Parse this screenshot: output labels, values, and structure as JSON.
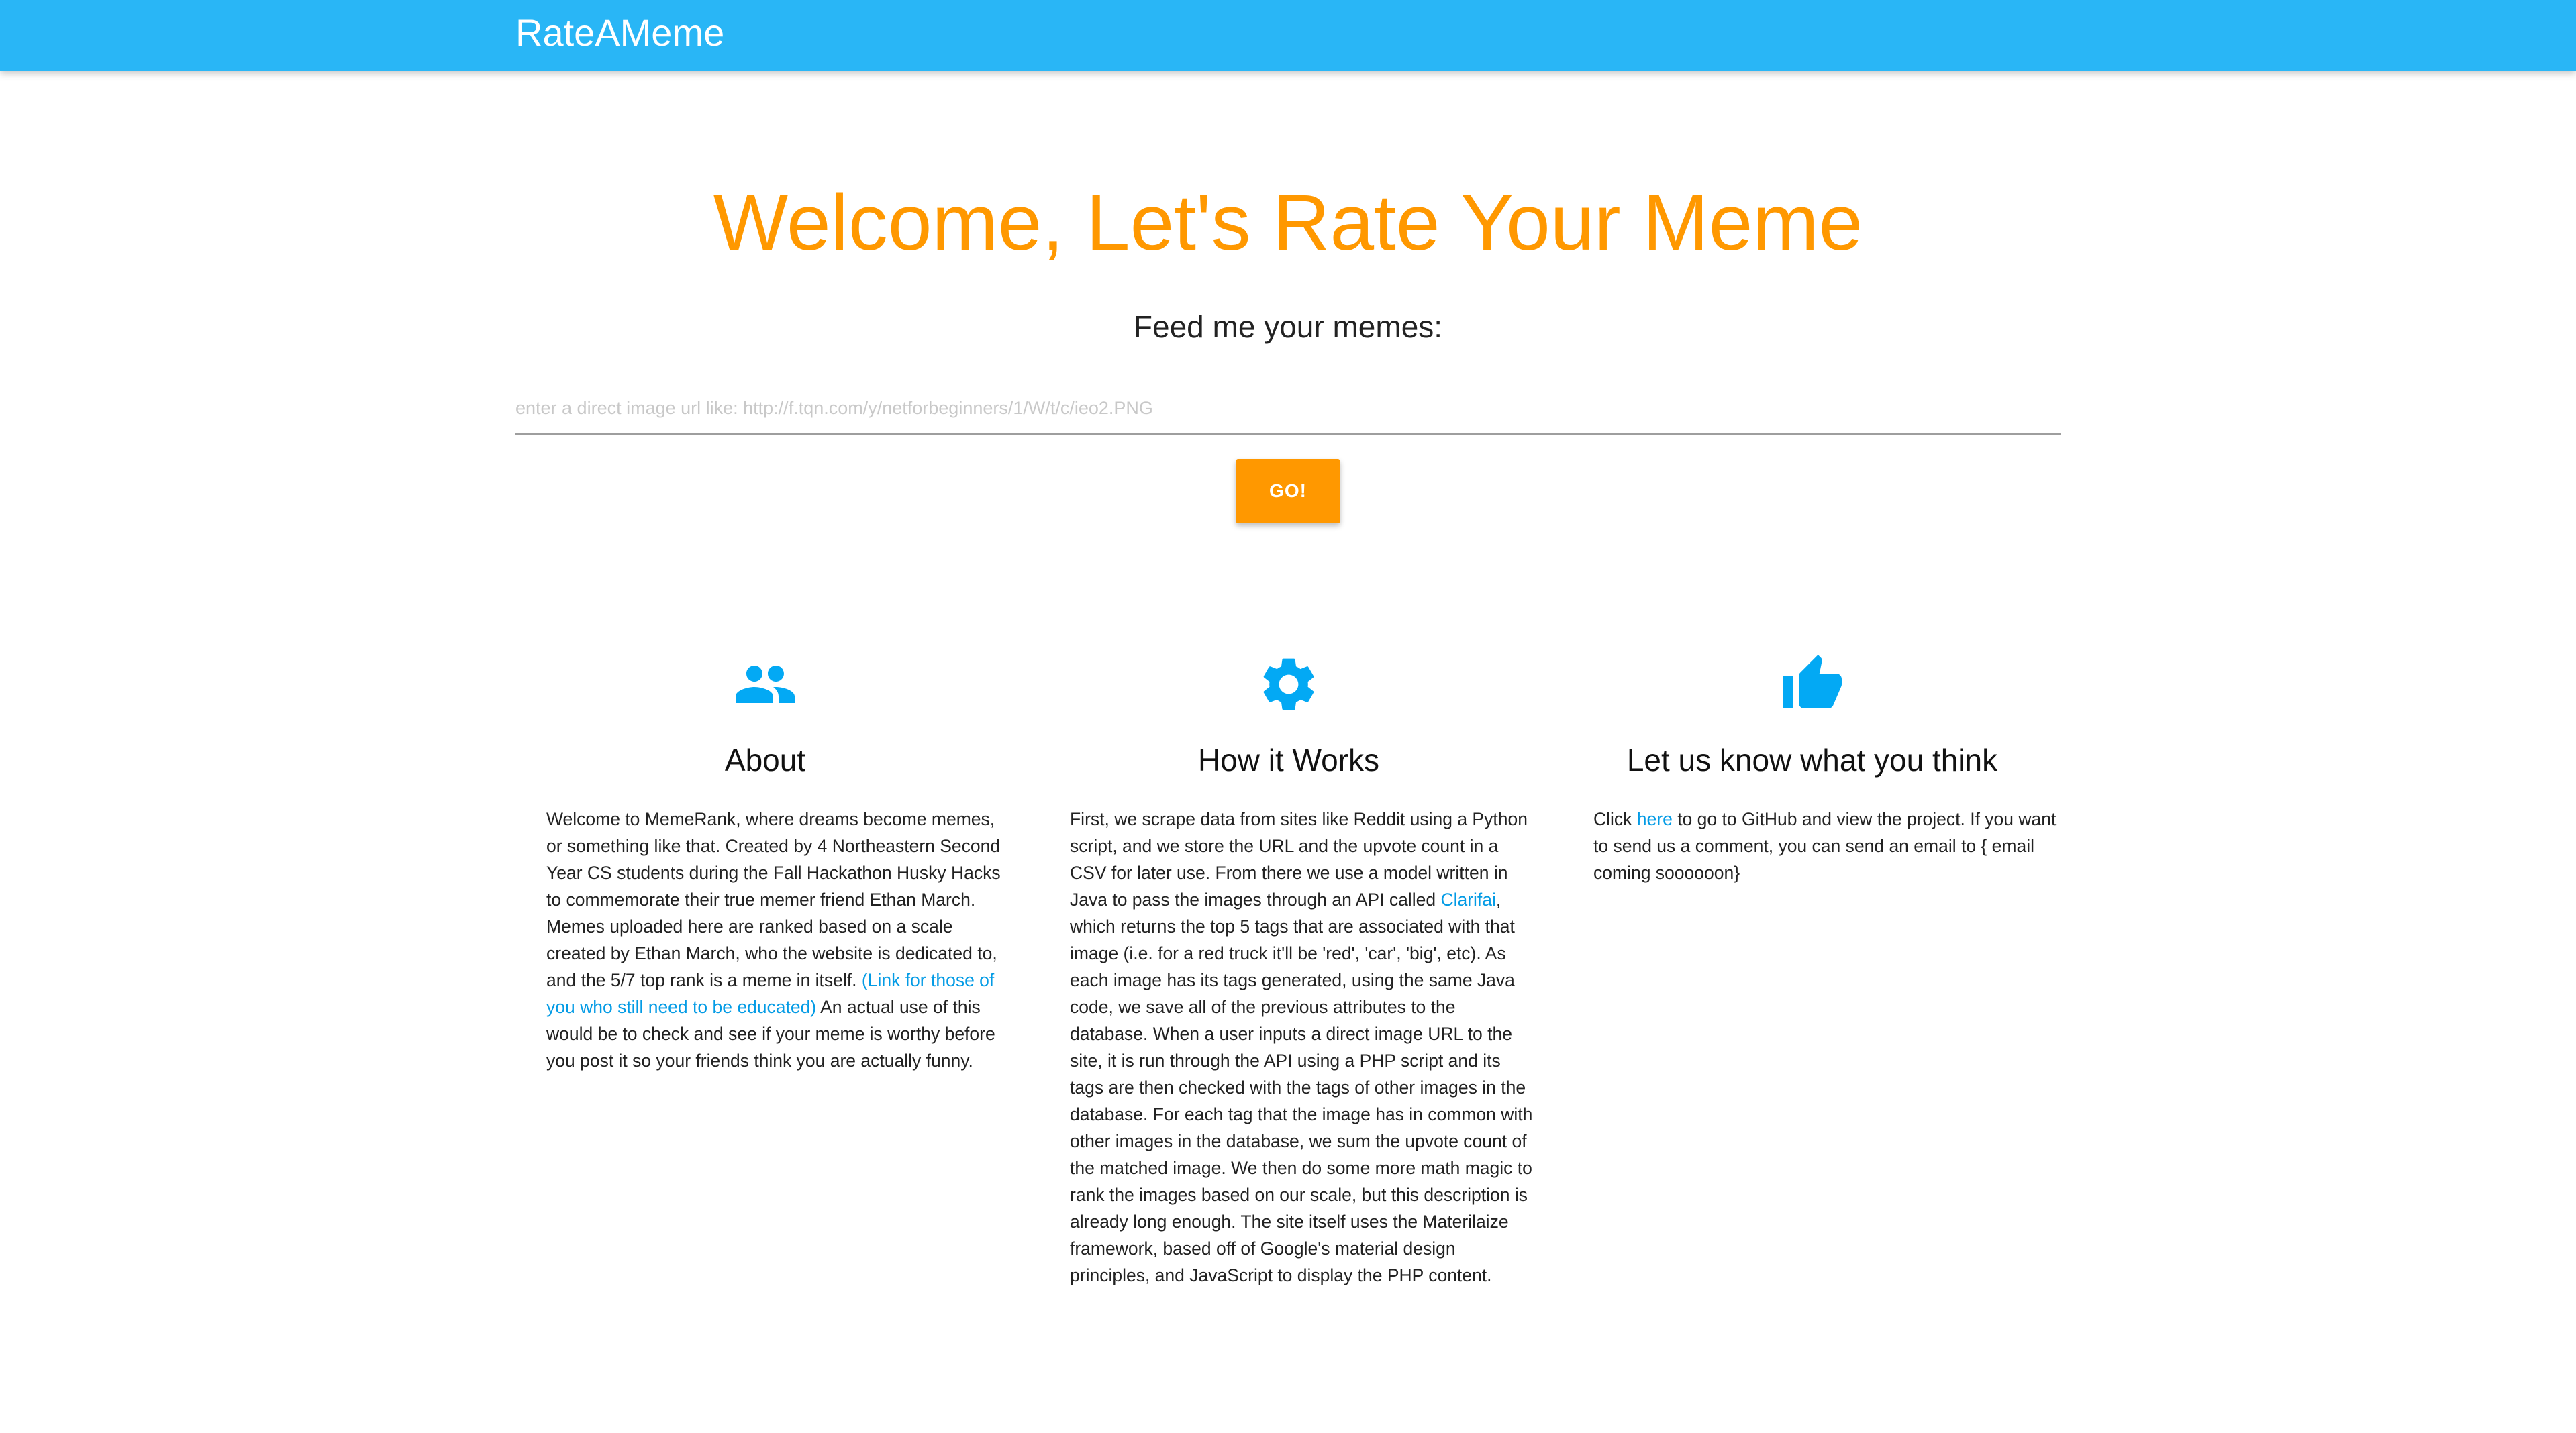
{
  "navbar": {
    "brand": "RateAMeme"
  },
  "hero": {
    "title": "Welcome, Let's Rate Your Meme",
    "subtitle": "Feed me your memes:"
  },
  "search": {
    "placeholder": "enter a direct image url like: http://f.tqn.com/y/netforbeginners/1/W/t/c/ieo2.PNG",
    "value": "",
    "button_label": "GO!"
  },
  "features": [
    {
      "icon": "people-icon",
      "title": "About",
      "text_1": "Welcome to MemeRank, where dreams become memes, or something like that. Created by 4 Northeastern Second Year CS students during the Fall Hackathon Husky Hacks to commemorate their true memer friend Ethan March. Memes uploaded here are ranked based on a scale created by Ethan March, who the website is dedicated to, and the 5/7 top rank is a meme in itself. ",
      "link": "(Link for those of you who still need to be educated)",
      "text_2": " An actual use of this would be to check and see if your meme is worthy before you post it so your friends think you are actually funny."
    },
    {
      "icon": "gear-icon",
      "title": "How it Works",
      "text_1": "First, we scrape data from sites like Reddit using a Python script, and we store the URL and the upvote count in a CSV for later use. From there we use a model written in Java to pass the images through an API called ",
      "link": "Clarifai",
      "text_2": ", which returns the top 5 tags that are associated with that image (i.e. for a red truck it'll be 'red', 'car', 'big', etc). As each image has its tags generated, using the same Java code, we save all of the previous attributes to the database. When a user inputs a direct image URL to the site, it is run through the API using a PHP script and its tags are then checked with the tags of other images in the database. For each tag that the image has in common with other images in the database, we sum the upvote count of the matched image. We then do some more math magic to rank the images based on our scale, but this description is already long enough. The site itself uses the Materilaize framework, based off of Google's material design principles, and JavaScript to display the PHP content."
    },
    {
      "icon": "thumbs-up-icon",
      "title": "Let us know what you think",
      "text_1": "Click ",
      "link": "here",
      "text_2": " to go to GitHub and view the project. If you want to send us a comment, you can send an email to { email coming soooooon}"
    }
  ],
  "colors": {
    "navbar": "#29b6f6",
    "accent": "#ff9800",
    "icon": "#03a9f4",
    "link": "#039be5"
  }
}
